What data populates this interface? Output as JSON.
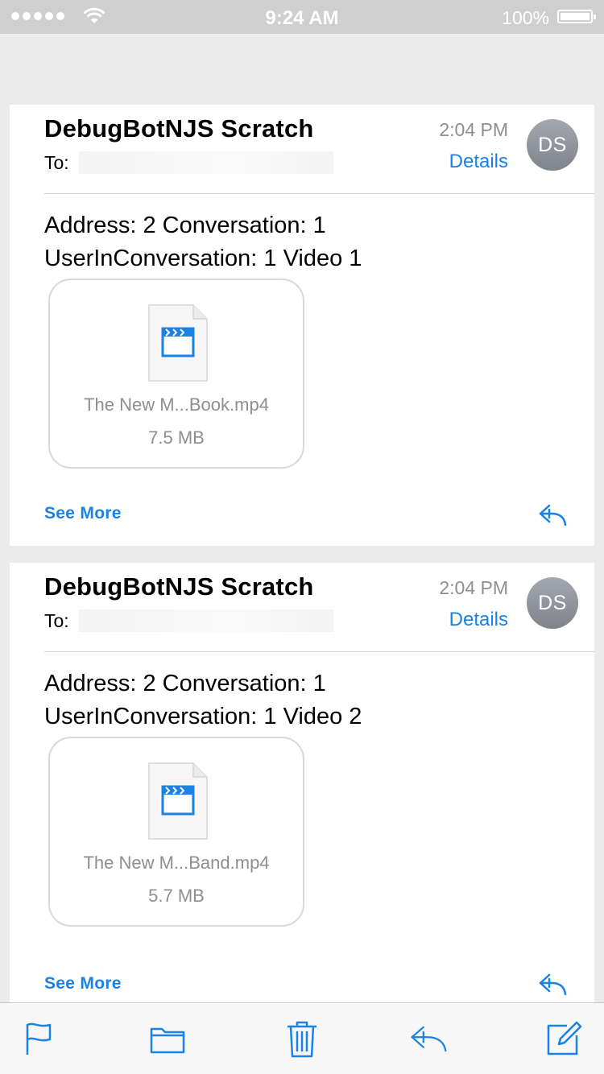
{
  "status_bar": {
    "time": "9:24 AM",
    "battery": "100%",
    "icons": [
      "signal-dots-icon",
      "wifi-icon",
      "battery-icon"
    ]
  },
  "messages": [
    {
      "sender": "DebugBotNJS Scratch",
      "to_label": "To:",
      "time": "2:04 PM",
      "details": "Details",
      "avatar": "DS",
      "body": [
        "Address: 2 Conversation: 1",
        "UserInConversation: 1 Video 1"
      ],
      "attachment": {
        "name": "The New M...Book.mp4",
        "size": "7.5 MB",
        "icon": "video-file-icon"
      },
      "see_more": "See More"
    },
    {
      "sender": "DebugBotNJS Scratch",
      "to_label": "To:",
      "time": "2:04 PM",
      "details": "Details",
      "avatar": "DS",
      "body": [
        "Address: 2 Conversation: 1",
        "UserInConversation: 1 Video 2"
      ],
      "attachment": {
        "name": "The New M...Band.mp4",
        "size": "5.7 MB",
        "icon": "video-file-icon"
      },
      "see_more": "See More"
    }
  ],
  "toolbar": {
    "buttons": [
      "flag-icon",
      "folder-icon",
      "trash-icon",
      "reply-icon",
      "compose-icon"
    ]
  },
  "colors": {
    "accent": "#1a82e6",
    "secondary_text": "#8e8e93",
    "background": "#ebebeb"
  }
}
